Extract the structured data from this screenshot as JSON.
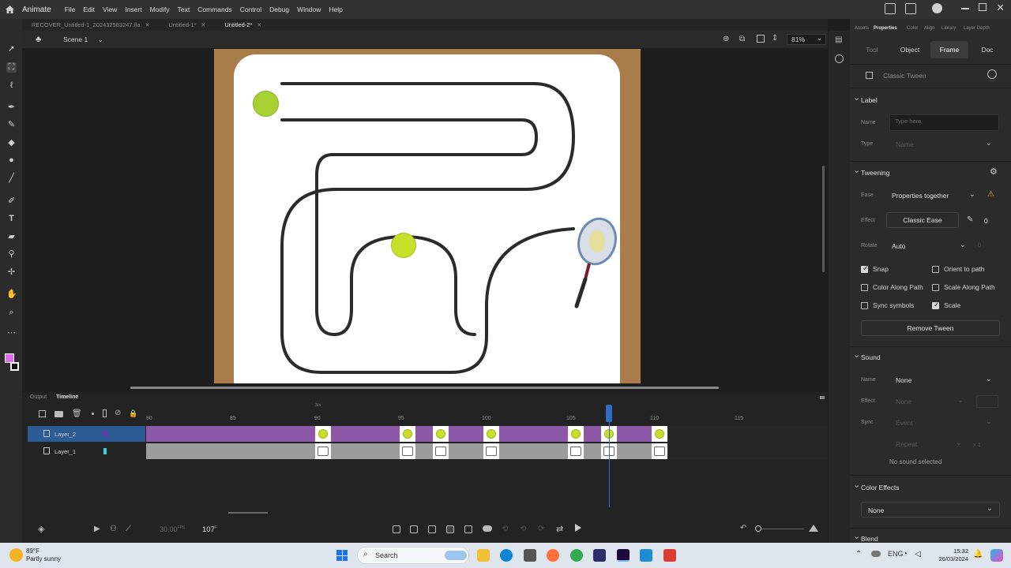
{
  "app": {
    "name": "Animate",
    "menu": [
      "File",
      "Edit",
      "View",
      "Insert",
      "Modify",
      "Text",
      "Commands",
      "Control",
      "Debug",
      "Window",
      "Help"
    ]
  },
  "doc_tabs": [
    {
      "label": "RECOVER_Untitled-1_202432583247.fla",
      "active": false
    },
    {
      "label": "Untitled-1*",
      "active": false
    },
    {
      "label": "Untitled-2*",
      "active": true
    }
  ],
  "scene": {
    "label": "Scene 1",
    "zoom": "81%"
  },
  "panel_tabs": [
    "Assets",
    "Properties",
    "Color",
    "Align",
    "Library",
    "Layer Depth"
  ],
  "props": {
    "subtabs": [
      "Tool",
      "Object",
      "Frame",
      "Doc"
    ],
    "active_subtab": "Frame",
    "tween_type": "Classic Tween",
    "label_section": "Label",
    "name_label": "Name",
    "name_placeholder": "Type here",
    "type_label": "Type",
    "type_value": "Name",
    "tweening_section": "Tweening",
    "ease_label": "Ease",
    "ease_value": "Properties together",
    "effect_label": "Effect",
    "effect_value": "Classic Ease",
    "effect_number": "0",
    "rotate_label": "Rotate",
    "rotate_value": "Auto",
    "rotate_number": "0",
    "checkboxes": {
      "snap": "Snap",
      "orient": "Orient to path",
      "color_along": "Color Along Path",
      "scale_along": "Scale Along Path",
      "sync": "Sync symbols",
      "scale": "Scale"
    },
    "remove_tween": "Remove Tween",
    "sound_section": "Sound",
    "sound_name_label": "Name",
    "sound_name_value": "None",
    "sound_effect_label": "Effect",
    "sound_effect_value": "None",
    "sync_label": "Sync",
    "sync_value": "Event",
    "repeat_value": "Repeat",
    "repeat_count": "x 1",
    "no_sound": "No sound selected",
    "color_effects_section": "Color Effects",
    "color_effects_value": "None",
    "blend_section": "Blend"
  },
  "timeline": {
    "tabs": [
      "Output",
      "Timeline"
    ],
    "active_tab": "Timeline",
    "ticks": [
      "80",
      "85",
      "90",
      "95",
      "100",
      "105",
      "110",
      "115"
    ],
    "fps_marker": "3/s",
    "layers": [
      {
        "name": "Layer_2",
        "color": "#7a2fb0",
        "selected": true
      },
      {
        "name": "Layer_1",
        "color": "#32d8d8",
        "selected": false
      }
    ],
    "fps": "30,00",
    "fps_unit": "FPS",
    "current_frame": "107",
    "frame_unit": "F",
    "keyframe_numbers": [
      90,
      95,
      97,
      100,
      105,
      107,
      110
    ]
  },
  "taskbar": {
    "weather_temp": "89°F",
    "weather_desc": "Partly sunny",
    "search": "Search",
    "time": "15:32",
    "date": "26/03/2024"
  },
  "colors": {
    "layer2_track": "#8e58a8",
    "layer1_track": "#9c9c9c",
    "playhead": "#2e6fc4",
    "tennis_ball": "#c8de2a",
    "court_brown": "#a87d49"
  }
}
